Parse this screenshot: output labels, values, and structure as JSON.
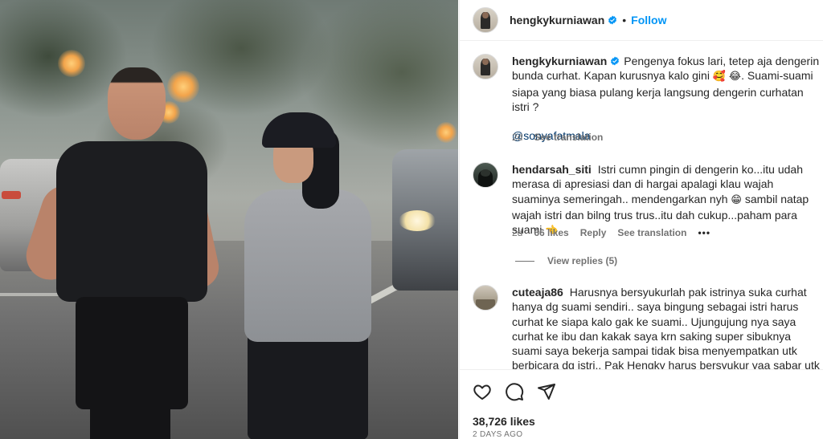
{
  "post": {
    "username": "hengkykurniawan",
    "follow_label": "Follow",
    "separator": "•",
    "image_alt_icon": "post-photo"
  },
  "caption": {
    "username": "hengkykurniawan",
    "text_1": "Pengenya fokus lari, tetep aja dengerin bunda curhat. Kapan kurusnya kalo gini",
    "emoji_1": "🥰",
    "emoji_2": "😂",
    "text_2": ". Suami-suami siapa yang biasa pulang kerja langsung dengerin curhatan istri ?",
    "mention": "@sonyafatmala",
    "time": "2d",
    "see_translation": "See translation"
  },
  "comments": [
    {
      "username": "hendarsah_siti",
      "text_1": "Istri cumn pingin di dengerin ko...itu udah merasa di apresiasi dan di hargai apalagi klau wajah suaminya semeringah.. mendengarkan nyh",
      "emoji_1": "😁",
      "text_2": "sambil natap wajah istri dan bilng trus trus..itu dah cukup...paham para suami",
      "emoji_2": "👈",
      "time": "2d",
      "likes": "66 likes",
      "reply": "Reply",
      "see_translation": "See translation",
      "more": "•••",
      "view_replies": "View replies (5)"
    },
    {
      "username": "cuteaja86",
      "text": "Harusnya bersyukurlah pak istrinya suka curhat hanya dg suami sendiri.. saya bingung sebagai istri harus curhat ke siapa kalo gak ke suami.. Ujungujung nya saya curhat ke ibu dan kakak saya krn saking super sibuknya suami saya bekerja sampai tidak bisa menyempatkan utk berbicara dg istri.. Pak Hengky harus bersyukur yaa sabar utk mendengarkan"
    }
  ],
  "actions": {
    "likes": "38,726 likes",
    "date": "2 DAYS AGO"
  },
  "colors": {
    "accent": "#0095f6",
    "verified": "#0095f6",
    "secondary_text": "#737373",
    "mention": "#00376b"
  }
}
